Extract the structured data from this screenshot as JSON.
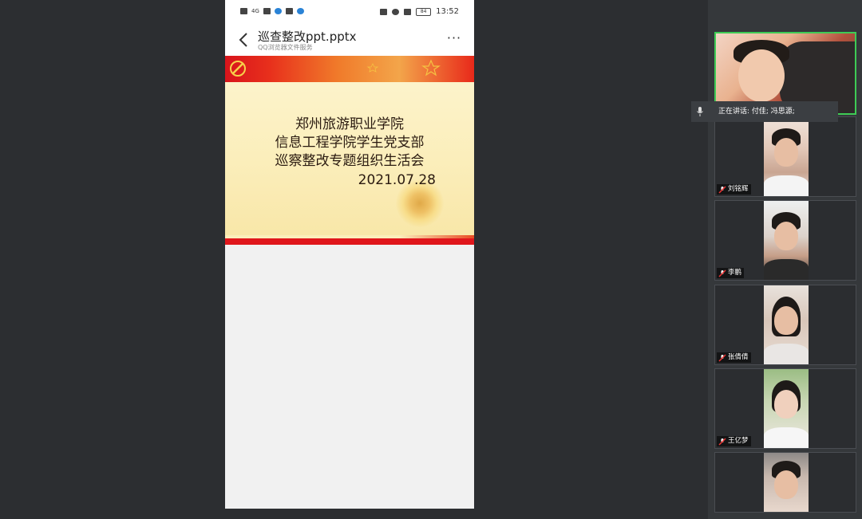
{
  "phone": {
    "status": {
      "carrier": "HD",
      "network": "4G",
      "battery": "84",
      "time": "13:52"
    },
    "titlebar": {
      "title": "巡查整改ppt.pptx",
      "subtitle": "QQ浏览器文件服务",
      "more": "···"
    },
    "slide": {
      "line1": "郑州旅游职业学院",
      "line2": "信息工程学院学生党支部",
      "line3": "巡察整改专题组织生活会",
      "date": "2021.07.28"
    }
  },
  "meeting": {
    "speaking_text": "正在讲话: 付佳; 冯思源;",
    "participants": [
      {
        "name": "刘铭辉"
      },
      {
        "name": "李鹏"
      },
      {
        "name": "张倩倩"
      },
      {
        "name": "王亿梦"
      },
      {
        "name": ""
      }
    ],
    "active_color": "#3ecb55"
  }
}
